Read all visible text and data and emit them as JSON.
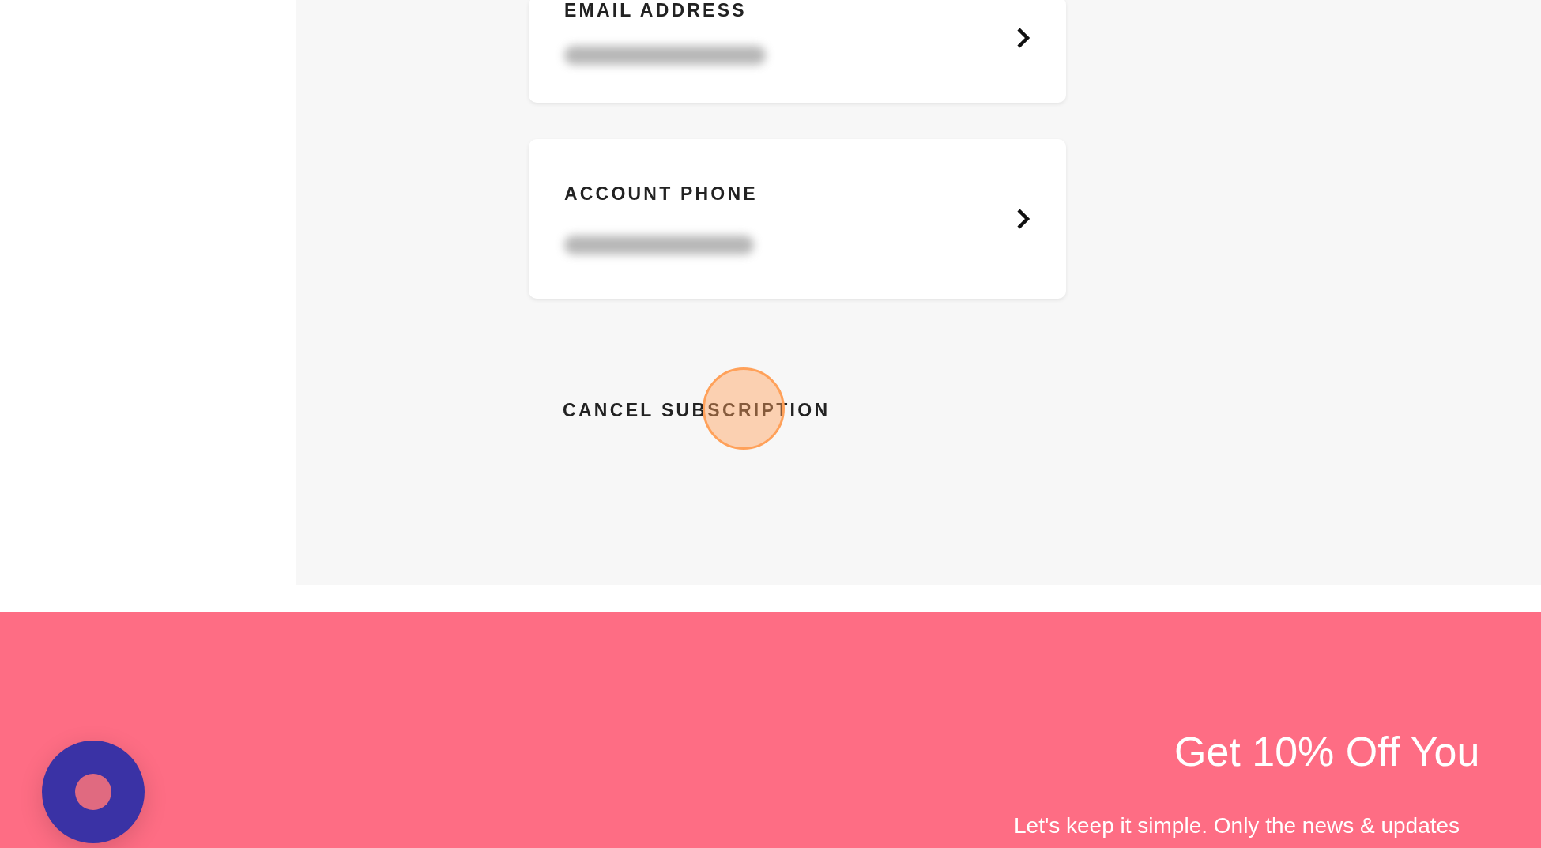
{
  "account_cards": [
    {
      "label": "EMAIL ADDRESS"
    },
    {
      "label": "ACCOUNT PHONE"
    }
  ],
  "cancel_button": {
    "label": "CANCEL SUBSCRIPTION"
  },
  "footer": {
    "heading": "Get 10% Off You",
    "text": "Let's keep it simple. Only the news & updates"
  }
}
